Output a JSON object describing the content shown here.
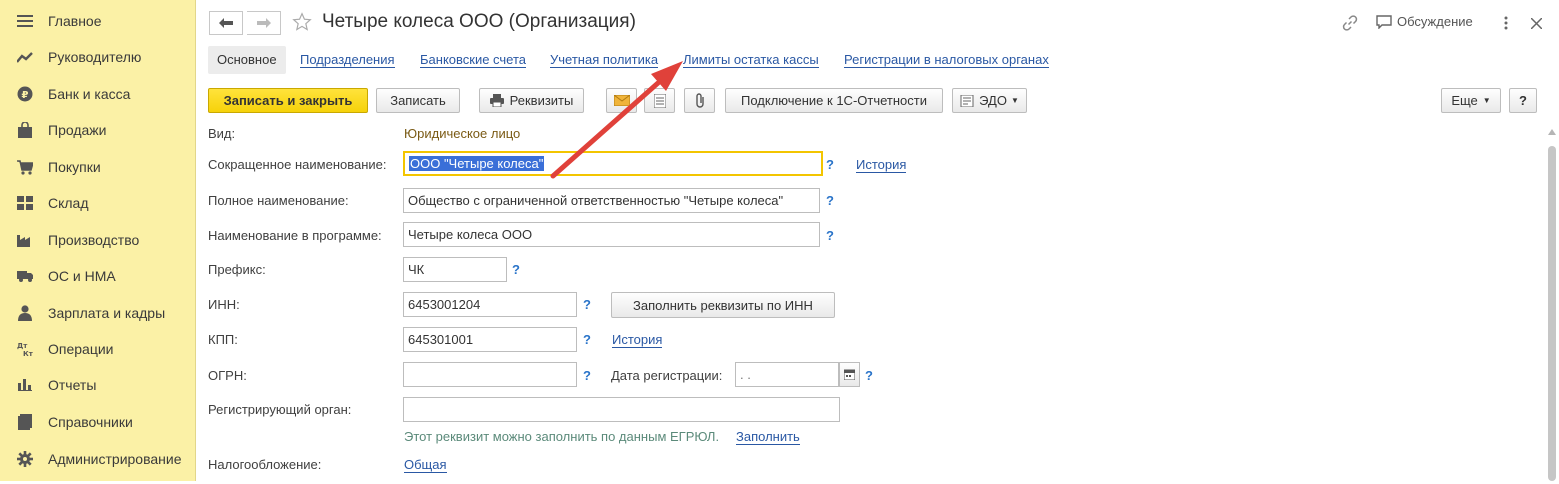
{
  "sidebar": {
    "items": [
      {
        "label": "Главное",
        "icon": "menu-icon"
      },
      {
        "label": "Руководителю",
        "icon": "trend-icon"
      },
      {
        "label": "Банк и касса",
        "icon": "ruble-coin-icon"
      },
      {
        "label": "Продажи",
        "icon": "shopping-bag-icon"
      },
      {
        "label": "Покупки",
        "icon": "cart-icon"
      },
      {
        "label": "Склад",
        "icon": "warehouse-icon"
      },
      {
        "label": "Производство",
        "icon": "factory-icon"
      },
      {
        "label": "ОС и НМА",
        "icon": "truck-icon"
      },
      {
        "label": "Зарплата и кадры",
        "icon": "person-icon"
      },
      {
        "label": "Операции",
        "icon": "dt-kt-icon"
      },
      {
        "label": "Отчеты",
        "icon": "bar-chart-icon"
      },
      {
        "label": "Справочники",
        "icon": "book-icon"
      },
      {
        "label": "Администрирование",
        "icon": "gear-icon"
      }
    ]
  },
  "header": {
    "title": "Четыре колеса ООО (Организация)",
    "discussion_label": "Обсуждение"
  },
  "tabs": [
    {
      "label": "Основное",
      "active": true
    },
    {
      "label": "Подразделения",
      "active": false
    },
    {
      "label": "Банковские счета",
      "active": false
    },
    {
      "label": "Учетная политика",
      "active": false
    },
    {
      "label": "Лимиты остатка кассы",
      "active": false
    },
    {
      "label": "Регистрации в налоговых органах",
      "active": false
    }
  ],
  "toolbar": {
    "save_close": "Записать и закрыть",
    "save": "Записать",
    "requisites": "Реквизиты",
    "connect_1c": "Подключение к 1С-Отчетности",
    "edo": "ЭДО",
    "more": "Еще",
    "help": "?"
  },
  "form": {
    "kind_label": "Вид:",
    "kind_value": "Юридическое лицо",
    "short_name_label": "Сокращенное наименование:",
    "short_name_value": "ООО \"Четыре колеса\"",
    "full_name_label": "Полное наименование:",
    "full_name_value": "Общество с ограниченной ответственностью \"Четыре колеса\"",
    "program_name_label": "Наименование в программе:",
    "program_name_value": "Четыре колеса ООО",
    "prefix_label": "Префикс:",
    "prefix_value": "ЧК",
    "inn_label": "ИНН:",
    "inn_value": "6453001204",
    "fill_by_inn": "Заполнить реквизиты по ИНН",
    "kpp_label": "КПП:",
    "kpp_value": "645301001",
    "history_link": "История",
    "ogrn_label": "ОГРН:",
    "ogrn_value": "",
    "reg_date_label": "Дата регистрации:",
    "reg_date_value": " .  .",
    "reg_organ_label": "Регистрирующий орган:",
    "reg_organ_value": "",
    "egrul_hint": "Этот реквизит можно заполнить по данным ЕГРЮЛ.",
    "fill_link": "Заполнить",
    "taxation_label": "Налогообложение:",
    "taxation_value": "Общая",
    "help_mark": "?"
  },
  "colors": {
    "sidebar_bg": "#fbf1a6",
    "primary_button": "#f6d20a",
    "link": "#2a58a4",
    "help": "#2a74c9",
    "kind_value": "#7a5a14",
    "annotation_arrow": "#e0413a"
  }
}
